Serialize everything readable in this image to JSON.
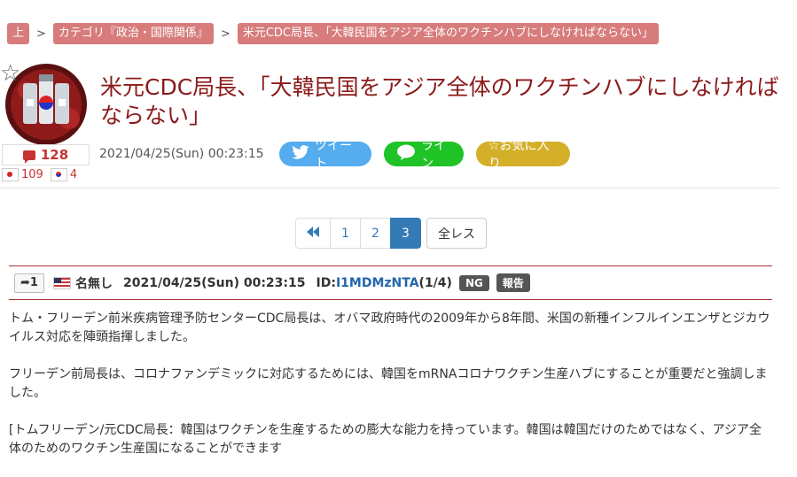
{
  "breadcrumb": {
    "home": "上",
    "sep": ">",
    "category": "カテゴリ『政治・国際関係』",
    "current": "米元CDC局長、「大韓民国をアジア全体のワクチンハブにしなければならない」"
  },
  "thread": {
    "title": "米元CDC局長、「大韓民国をアジア全体のワクチンハブにしなければならない」",
    "date": "2021/04/25(Sun) 00:23:15",
    "comment_count": "128",
    "flag_counts": [
      {
        "country": "jp",
        "count": "109"
      },
      {
        "country": "kr",
        "count": "4"
      }
    ]
  },
  "share": {
    "twitter_label": "ツイート",
    "line_label": "ライン",
    "favorite_label": "☆お気に入り"
  },
  "pagination": {
    "first_icon": "double-left",
    "pages": [
      "1",
      "2",
      "3"
    ],
    "active_page": "3",
    "all_label": "全レス"
  },
  "post": {
    "number": "1",
    "name": "名無し",
    "date": "2021/04/25(Sun) 00:23:15",
    "id_prefix": "ID:",
    "id": "I1MDMzNTA",
    "id_count": "(1/4)",
    "ng_label": "NG",
    "report_label": "報告",
    "paragraphs": [
      "トム・フリーデン前米疾病管理予防センターCDC局長は、オバマ政府時代の2009年から8年間、米国の新種インフルインエンザとジカウイルス対応を陣頭指揮しました。",
      "フリーデン前局長は、コロナファンデミックに対応するためには、韓国をmRNAコロナワクチン生産ハブにすることが重要だと強調しました。",
      "[トムフリーデン/元CDC局長：韓国はワクチンを生産するための膨大な能力を持っています。韓国は韓国だけのためではなく、アジア全体のためのワクチン生産国になることができます"
    ]
  },
  "colors": {
    "crumb_bg": "#d77b7b",
    "title": "#8b1a1a",
    "twitter": "#55acee",
    "line": "#1fc326",
    "favorite": "#d4b02a",
    "pager_active": "#337ab7"
  }
}
